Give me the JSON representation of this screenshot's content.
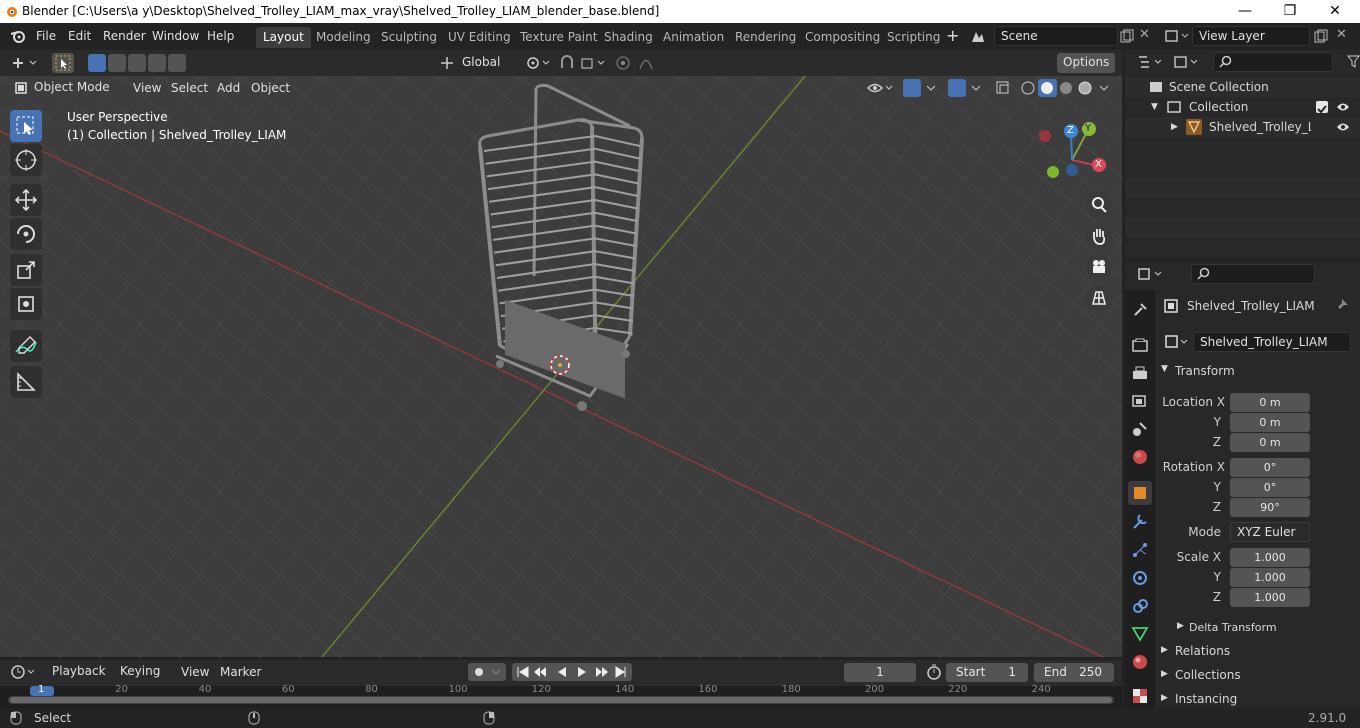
{
  "window": {
    "title": "Blender [C:\\Users\\a y\\Desktop\\Shelved_Trolley_LIAM_max_vray\\Shelved_Trolley_LIAM_blender_base.blend]",
    "min": "—",
    "max": "❐",
    "close": "✕"
  },
  "menu": [
    "File",
    "Edit",
    "Render",
    "Window",
    "Help"
  ],
  "workspaces": [
    "Layout",
    "Modeling",
    "Sculpting",
    "UV Editing",
    "Texture Paint",
    "Shading",
    "Animation",
    "Rendering",
    "Compositing",
    "Scripting"
  ],
  "scene": "Scene",
  "view_layer": "View Layer",
  "toolbar": {
    "transform": "Global",
    "options": "Options"
  },
  "header": {
    "mode": "Object Mode",
    "items": [
      "View",
      "Select",
      "Add",
      "Object"
    ]
  },
  "viewport": {
    "perspective": "User Perspective",
    "collection": "(1) Collection | Shelved_Trolley_LIAM",
    "axes": [
      "X",
      "Y",
      "Z"
    ]
  },
  "outliner": {
    "scene_collection": "Scene Collection",
    "collection": "Collection",
    "object": "Shelved_Trolley_LIAM"
  },
  "properties": {
    "object_name": "Shelved_Trolley_LIAM",
    "data_name": "Shelved_Trolley_LIAM",
    "transform": "Transform",
    "location_label": "Location X",
    "y": "Y",
    "z": "Z",
    "loc": [
      "0 m",
      "0 m",
      "0 m"
    ],
    "rotation_label": "Rotation X",
    "rot": [
      "0°",
      "0°",
      "90°"
    ],
    "mode_label": "Mode",
    "mode": "XYZ Euler",
    "scale_label": "Scale X",
    "scale": [
      "1.000",
      "1.000",
      "1.000"
    ],
    "delta": "Delta Transform",
    "relations": "Relations",
    "collections": "Collections",
    "instancing": "Instancing"
  },
  "timeline": {
    "menus": [
      "Playback",
      "Keying",
      "View",
      "Marker"
    ],
    "frame": "1",
    "start_label": "Start",
    "start": "1",
    "end_label": "End",
    "end": "250",
    "ticks": [
      "1",
      "20",
      "40",
      "60",
      "80",
      "100",
      "120",
      "140",
      "160",
      "180",
      "200",
      "220",
      "240"
    ]
  },
  "status": {
    "select": "Select",
    "version": "2.91.0"
  }
}
